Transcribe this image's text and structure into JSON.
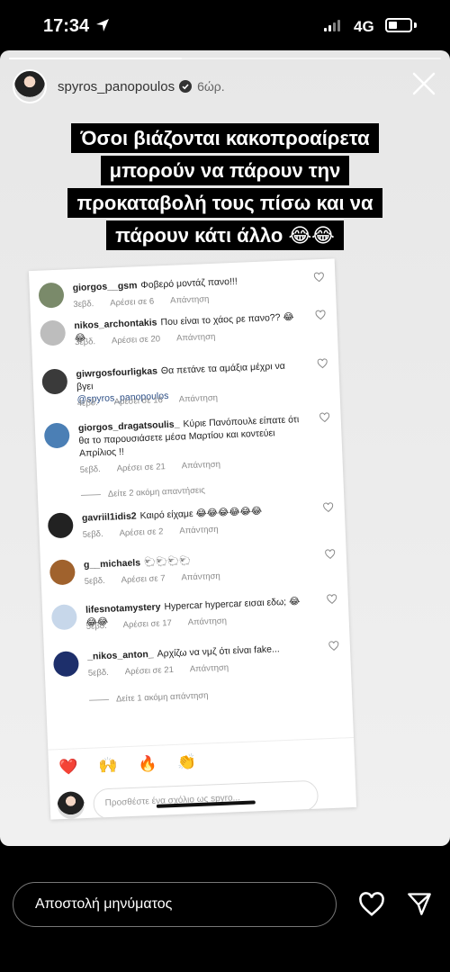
{
  "status_bar": {
    "time": "17:34",
    "network": "4G"
  },
  "story": {
    "progress": 0.4,
    "username": "spyros_panopoulos",
    "age": "6ώρ.",
    "caption": "Όσοι βιάζονται κακοπροαίρετα μπορούν να πάρουν την προκαταβολή τους πίσω και να πάρουν κάτι άλλο 😂😂"
  },
  "screenshot": {
    "comments": [
      {
        "user": "giorgos__gsm",
        "text": "Φοβερό μοντάζ πανο!!!",
        "time": "3εβδ.",
        "likes": "Αρέσει σε 6",
        "reply": "Απάντηση",
        "avatar_color": "#7a8a6a"
      },
      {
        "user": "nikos_archontakis",
        "text": "Που είναι το χάος ρε πανο?? 😂😂",
        "time": "3εβδ.",
        "likes": "Αρέσει σε 20",
        "reply": "Απάντηση",
        "avatar_color": "#bdbdbd"
      },
      {
        "user": "giwrgosfourligkas",
        "text": "Θα πετάνε τα αμάξια μέχρι να βγει",
        "mention": "@spyros_panopoulos",
        "time": "4εβδ.",
        "likes": "Αρέσει σε 16",
        "reply": "Απάντηση",
        "avatar_color": "#3a3a3a"
      },
      {
        "user": "giorgos_dragatsoulis_",
        "text": "Κύριε Πανόπουλε είπατε ότι θα το παρουσιάσετε μέσα Μαρτίου και κοντεύει Απρίλιος !!",
        "time": "5εβδ.",
        "likes": "Αρέσει σε 21",
        "reply": "Απάντηση",
        "avatar_color": "#4b7fb5"
      },
      {
        "user": "gavriil1idis2",
        "text": "Καιρό είχαμε 😂😂😂😂😂😂",
        "time": "5εβδ.",
        "likes": "Αρέσει σε 2",
        "reply": "Απάντηση",
        "avatar_color": "#222222"
      },
      {
        "user": "g__michaels",
        "text": "🐑🐑🐑🐑",
        "time": "5εβδ.",
        "likes": "Αρέσει σε 7",
        "reply": "Απάντηση",
        "avatar_color": "#a0622d"
      },
      {
        "user": "lifesnotamystery",
        "text": "Hypercar hypercar εισαι εδω; 😂😂😂",
        "time": "5εβδ.",
        "likes": "Αρέσει σε 17",
        "reply": "Απάντηση",
        "avatar_color": "#c7d7ea"
      },
      {
        "user": "_nikos_anton_",
        "text": "Αρχίζω να νμζ ότι είναι fake...",
        "time": "5εβδ.",
        "likes": "Αρέσει σε 21",
        "reply": "Απάντηση",
        "avatar_color": "#1d2f6b"
      }
    ],
    "more_replies_1": "Δείτε 2 ακόμη απαντήσεις",
    "more_replies_2": "Δείτε 1 ακόμη απάντηση",
    "reactions": [
      "❤️",
      "🙌",
      "🔥",
      "👏",
      "😢",
      "😍",
      "😮",
      "😂"
    ],
    "comment_placeholder": "Προσθέστε ένα σχόλιο ως spyro..."
  },
  "bottom_bar": {
    "message_placeholder": "Αποστολή μηνύματος"
  }
}
